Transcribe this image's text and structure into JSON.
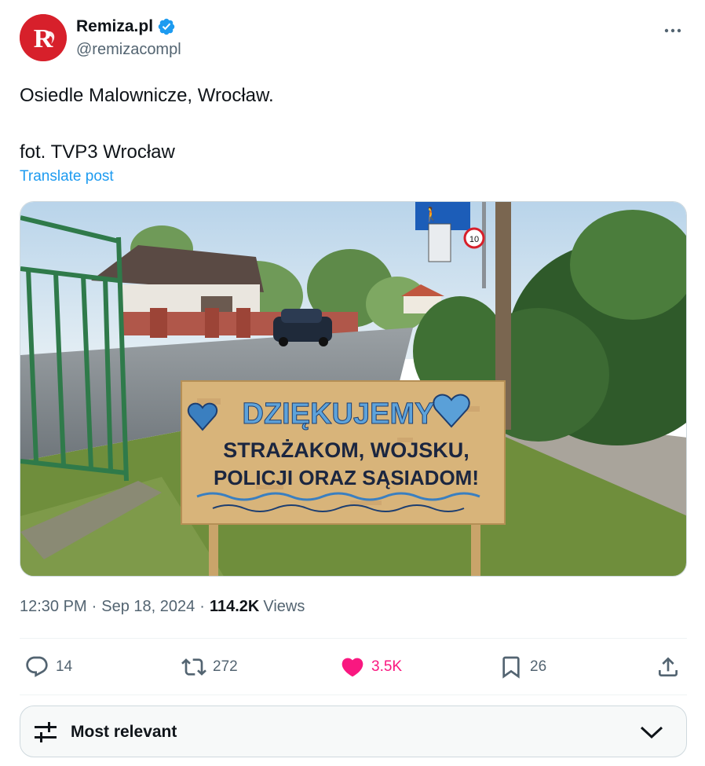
{
  "author": {
    "display_name": "Remiza.pl",
    "handle": "@remizacompl",
    "verified": true,
    "avatar_icon": "remiza-logo",
    "brand_color": "#d7202b"
  },
  "post": {
    "text_line1": "Osiedle Malownicze, Wrocław.",
    "text_line2": "fot. TVP3 Wrocław",
    "translate_label": "Translate post"
  },
  "media": {
    "sign_line1": "DZIĘKUJEMY",
    "sign_line2": "STRAŻAKOM, WOJSKU,",
    "sign_line3": "POLICJI ORAZ SĄSIADOM!",
    "speed_sign": "10"
  },
  "meta": {
    "time": "12:30 PM",
    "date": "Sep 18, 2024",
    "views_count": "114.2K",
    "views_label": "Views"
  },
  "actions": {
    "replies": "14",
    "reposts": "272",
    "likes": "3.5K",
    "bookmarks": "26",
    "like_color": "#f91880",
    "icons": [
      "reply-icon",
      "repost-icon",
      "heart-icon",
      "bookmark-icon",
      "share-icon"
    ]
  },
  "sort": {
    "label": "Most relevant",
    "icon": "sliders-icon"
  },
  "colors": {
    "link": "#1d9bf0",
    "secondary_text": "#536471",
    "verified": "#1d9bf0"
  }
}
